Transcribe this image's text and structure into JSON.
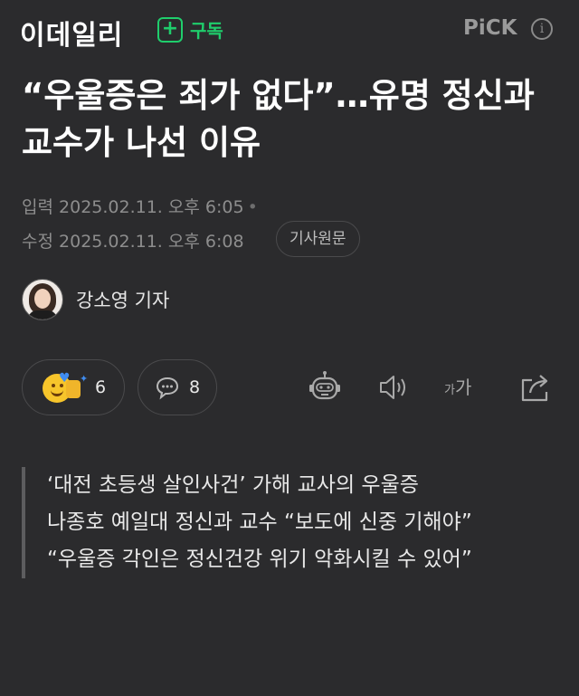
{
  "header": {
    "brand": "이데일리",
    "subscribe_label": "구독",
    "pick_label": "PiCK",
    "colors": {
      "accent_green": "#1fce6c",
      "background": "#2b2b2d"
    }
  },
  "article": {
    "headline": "“우울증은 죄가 없다”…유명 정신과 교수가 나선 이유",
    "input_label": "입력",
    "input_time": "2025.02.11. 오후 6:05",
    "modified_label": "수정",
    "modified_time": "2025.02.11. 오후 6:08",
    "original_button": "기사원문",
    "reporter": "강소영 기자",
    "lede": [
      "‘대전 초등생 살인사건’ 가해 교사의 우울증",
      "나종호 예일대 정신과 교수 “보도에 신중 기해야”",
      "“우울증 각인은 정신건강 위기 악화시킬 수 있어”"
    ]
  },
  "actions": {
    "reaction_count": "6",
    "comment_count": "8",
    "font_size_small": "가",
    "font_size_large": "가",
    "icons": [
      "reaction-emoji-icon",
      "comment-bubble-icon",
      "robot-summary-icon",
      "speaker-icon",
      "font-size-icon",
      "share-icon"
    ]
  }
}
